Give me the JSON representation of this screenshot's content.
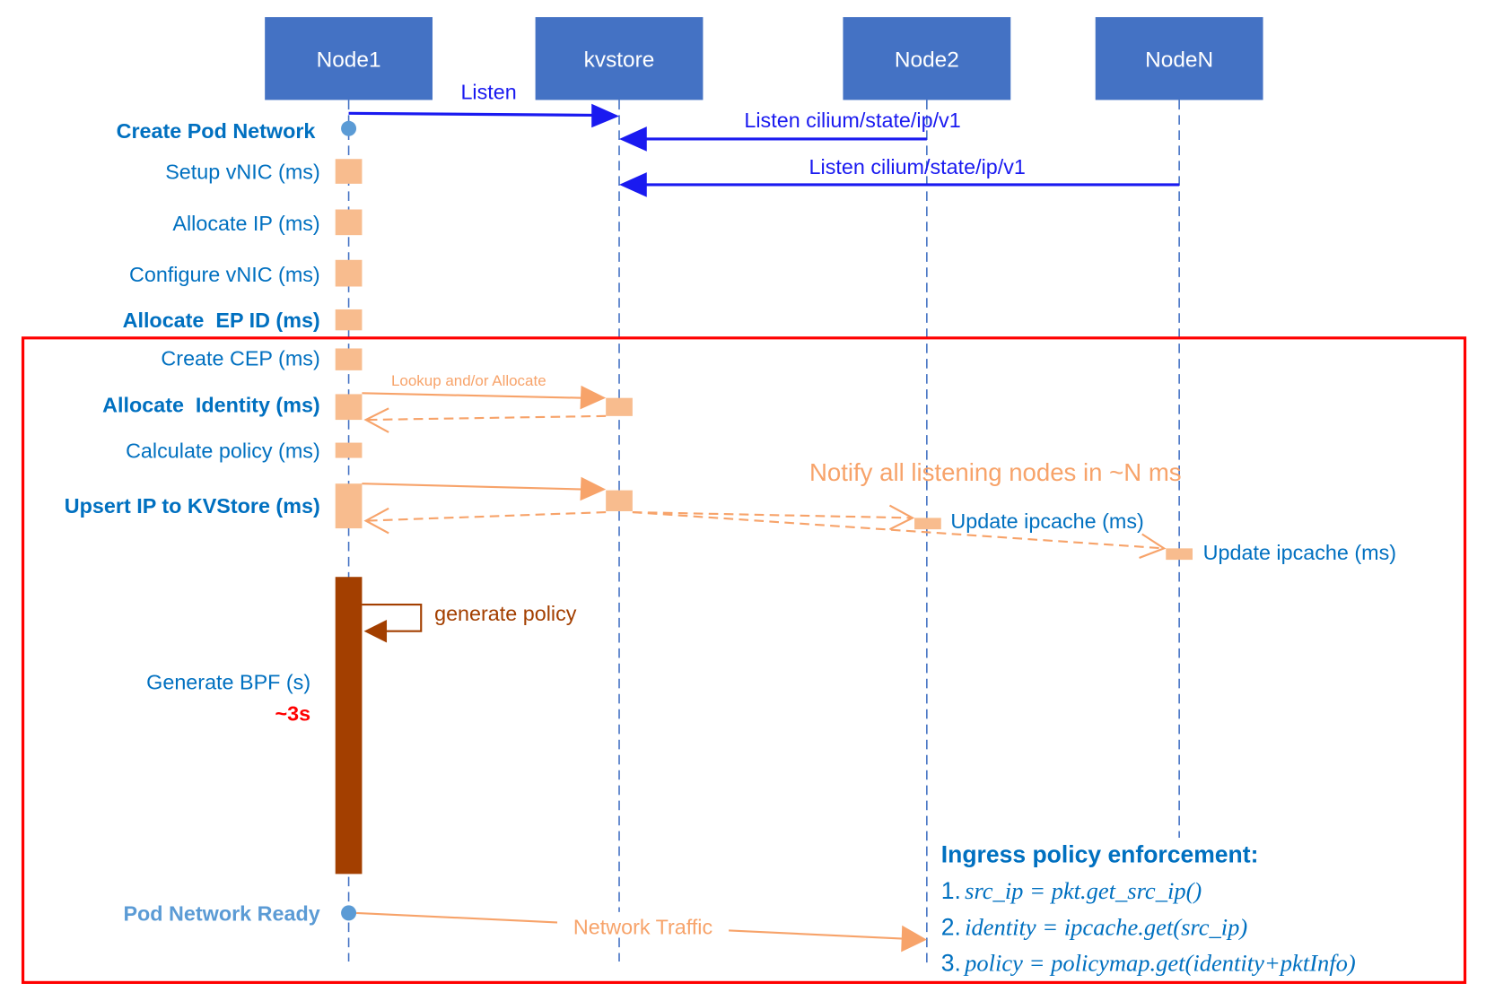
{
  "colors": {
    "participant_fill": "#4472C4",
    "label_blue": "#0070C0",
    "ready_blue": "#5B9BD5",
    "message_blue": "#1A1AF0",
    "activation_orange": "#F8BC8E",
    "arrow_orange": "#F7A36A",
    "bpf_brown": "#A33F00",
    "highlight_red": "#FF0000"
  },
  "participants": [
    "Node1",
    "kvstore",
    "Node2",
    "NodeN"
  ],
  "messages": {
    "listen": "Listen",
    "listen_node2": "Listen cilium/state/ip/v1",
    "listen_noden": "Listen cilium/state/ip/v1",
    "lookup": "Lookup and/or Allocate",
    "notify": "Notify all listening nodes in ~N ms",
    "update_node2": "Update ipcache (ms)",
    "update_noden": "Update ipcache (ms)",
    "generate_policy": "generate policy",
    "network_traffic": "Network Traffic"
  },
  "steps": {
    "create_pod_network": "Create Pod Network",
    "setup_vnic": "Setup vNIC (ms)",
    "allocate_ip": "Allocate IP (ms)",
    "configure_vnic": "Configure vNIC (ms)",
    "allocate_ep_id": "Allocate  EP ID (ms)",
    "create_cep": "Create CEP (ms)",
    "allocate_identity": "Allocate  Identity (ms)",
    "calculate_policy": "Calculate policy (ms)",
    "upsert_ip": "Upsert IP to KVStore (ms)",
    "generate_bpf": "Generate BPF (s)",
    "generate_bpf_duration": "~3s",
    "pod_network_ready": "Pod Network Ready"
  },
  "enforcement": {
    "title": "Ingress policy enforcement:",
    "items": [
      {
        "num": "1.",
        "code": "src_ip = pkt.get_src_ip()"
      },
      {
        "num": "2.",
        "code": "identity = ipcache.get(src_ip)"
      },
      {
        "num": "3.",
        "code": "policy = policymap.get(identity+pktInfo)"
      }
    ]
  }
}
